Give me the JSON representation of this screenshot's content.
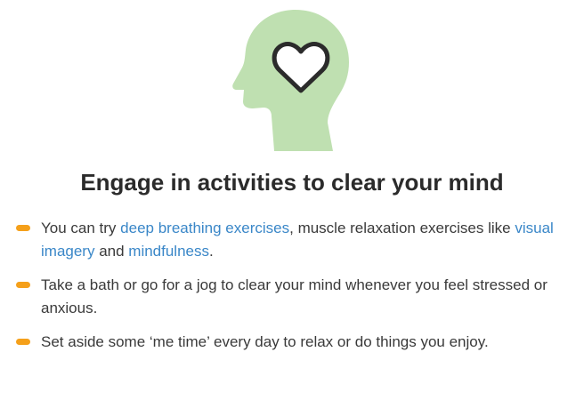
{
  "illustration": {
    "icon": "head-with-heart-icon",
    "head_color": "#bfe0b1",
    "heart_color": "#2b2b2b"
  },
  "title": "Engage in activities to clear your mind",
  "accent_color": "#f5a01a",
  "link_color": "#3a87c8",
  "tips": [
    {
      "text_1": "You can try ",
      "link_1": "deep breathing exercises",
      "text_2": ", muscle relaxation exercises like ",
      "link_2": "visual imagery",
      "text_3": " and ",
      "link_3": "mindfulness",
      "text_4": "."
    },
    {
      "text": "Take a bath or go for a jog to clear your mind whenever you feel stressed or anxious."
    },
    {
      "text": "Set aside some ‘me time’ every day to relax or do things you enjoy."
    }
  ]
}
